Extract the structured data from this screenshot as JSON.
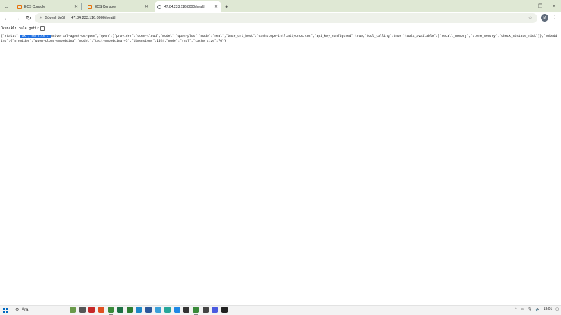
{
  "browser": {
    "tabs": [
      {
        "title": "ECS Console",
        "active": false,
        "icon": "ecs-console-icon"
      },
      {
        "title": "ECS Console",
        "active": false,
        "icon": "ecs-console-icon"
      },
      {
        "title": "47.84.233.116:8000/health",
        "active": true,
        "icon": "globe-icon"
      }
    ],
    "address_bar": {
      "security_label": "Güvenli değil",
      "url": "47.84.233.116:8000/health"
    },
    "profile_initial": "M"
  },
  "page": {
    "pretty_print_label": "Okunaklı hale getir",
    "json_before_selection": "{\"status\":",
    "json_selected": "\"ok\",\"service\":\"",
    "json_after_selection": "universal-agent-os-quen\",\"qwen\":{\"provider\":\"quen-cloud\",\"model\":\"quen-plus\",\"mode\":\"real\",\"base_url_host\":\"dashscope-intl.aliyuncs.com\",\"api_key_configured\":true,\"tool_calling\":true,\"tools_available\":[\"recall_memory\",\"store_memory\",\"check_mistake_risk\"]},\"embedding\":{\"provider\":\"quen-cloud-embedding\",\"model\":\"text-embedding-v3\",\"dimensions\":1024,\"mode\":\"real\",\"cache_size\":70}}"
  },
  "taskbar": {
    "search_label": "Ara",
    "time": "18:01",
    "apps": [
      {
        "name": "widgets-icon",
        "color": "#6a9a4a"
      },
      {
        "name": "task-view-icon",
        "color": "#555555"
      },
      {
        "name": "file-explorer-icon",
        "color": "#c62828"
      },
      {
        "name": "brave-icon",
        "color": "#e05020"
      },
      {
        "name": "chrome-icon",
        "color": "#3a8a3a"
      },
      {
        "name": "excel-icon",
        "color": "#1e7145"
      },
      {
        "name": "chrome-profile-icon",
        "color": "#2e7d32"
      },
      {
        "name": "edge-icon",
        "color": "#1e88c8"
      },
      {
        "name": "word-icon",
        "color": "#2b579a"
      },
      {
        "name": "browser-app-icon",
        "color": "#3aa0d8"
      },
      {
        "name": "app-icon",
        "color": "#26a69a"
      },
      {
        "name": "vscode-icon",
        "color": "#1e88e5"
      },
      {
        "name": "app-dark-icon",
        "color": "#333333"
      },
      {
        "name": "chrome-running-icon",
        "color": "#3a8a3a"
      },
      {
        "name": "terminal-icon",
        "color": "#444444"
      },
      {
        "name": "discord-icon",
        "color": "#4a5ae0"
      },
      {
        "name": "github-icon",
        "color": "#222222"
      }
    ]
  }
}
